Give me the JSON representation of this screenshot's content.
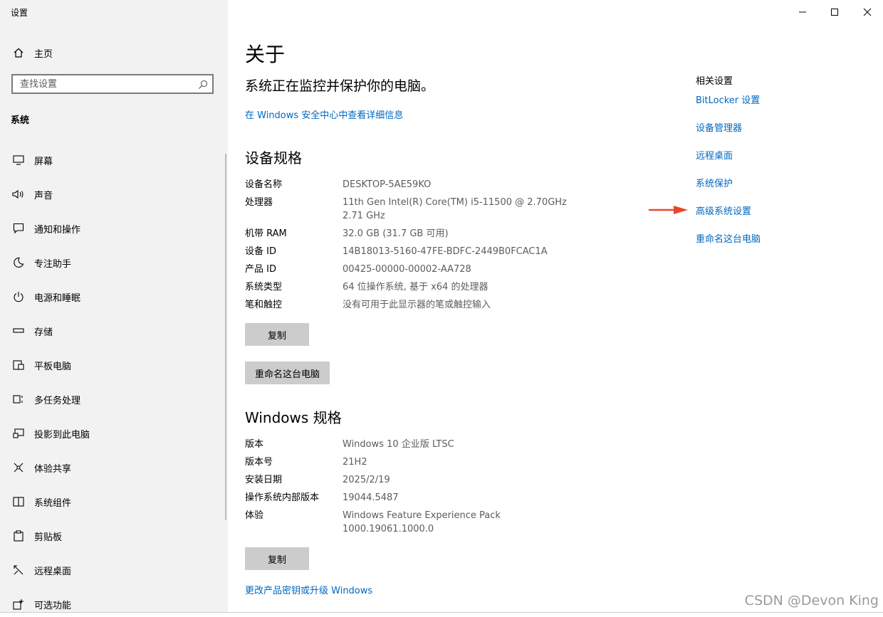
{
  "window": {
    "app_title": "设置",
    "controls": {
      "minimize": "minimize-icon",
      "maximize": "maximize-icon",
      "close": "close-icon"
    }
  },
  "sidebar": {
    "home_label": "主页",
    "search_placeholder": "查找设置",
    "section_label": "系统",
    "items": [
      {
        "label": "屏幕",
        "icon": "monitor-icon"
      },
      {
        "label": "声音",
        "icon": "speaker-icon"
      },
      {
        "label": "通知和操作",
        "icon": "notification-icon"
      },
      {
        "label": "专注助手",
        "icon": "moon-icon"
      },
      {
        "label": "电源和睡眠",
        "icon": "power-icon"
      },
      {
        "label": "存储",
        "icon": "storage-icon"
      },
      {
        "label": "平板电脑",
        "icon": "tablet-icon"
      },
      {
        "label": "多任务处理",
        "icon": "multitask-icon"
      },
      {
        "label": "投影到此电脑",
        "icon": "project-icon"
      },
      {
        "label": "体验共享",
        "icon": "share-icon"
      },
      {
        "label": "系统组件",
        "icon": "components-icon"
      },
      {
        "label": "剪贴板",
        "icon": "clipboard-icon"
      },
      {
        "label": "远程桌面",
        "icon": "remote-icon"
      },
      {
        "label": "可选功能",
        "icon": "optional-icon"
      }
    ]
  },
  "main": {
    "title": "关于",
    "protect_message": "系统正在监控并保护你的电脑。",
    "security_link": "在 Windows 安全中心中查看详细信息",
    "device_specs": {
      "heading": "设备规格",
      "rows": [
        {
          "key": "设备名称",
          "value": "DESKTOP-5AE59KO"
        },
        {
          "key": "处理器",
          "value": "11th Gen Intel(R) Core(TM) i5-11500 @ 2.70GHz",
          "value2": "2.71 GHz"
        },
        {
          "key": "机带 RAM",
          "value": "32.0 GB (31.7 GB 可用)"
        },
        {
          "key": "设备 ID",
          "value": "14B18013-5160-47FE-BDFC-2449B0FCAC1A"
        },
        {
          "key": "产品 ID",
          "value": "00425-00000-00002-AA728"
        },
        {
          "key": "系统类型",
          "value": "64 位操作系统, 基于 x64 的处理器"
        },
        {
          "key": "笔和触控",
          "value": "没有可用于此显示器的笔或触控输入"
        }
      ],
      "copy_button": "复制",
      "rename_button": "重命名这台电脑"
    },
    "windows_specs": {
      "heading": "Windows 规格",
      "rows": [
        {
          "key": "版本",
          "value": "Windows 10 企业版 LTSC"
        },
        {
          "key": "版本号",
          "value": "21H2"
        },
        {
          "key": "安装日期",
          "value": "2025/2/19"
        },
        {
          "key": "操作系统内部版本",
          "value": "19044.5487"
        },
        {
          "key": "体验",
          "value": "Windows Feature Experience Pack",
          "value2": "1000.19061.1000.0"
        }
      ],
      "copy_button": "复制",
      "product_key_link": "更改产品密钥或升级 Windows"
    }
  },
  "related": {
    "title": "相关设置",
    "links": [
      "BitLocker 设置",
      "设备管理器",
      "远程桌面",
      "系统保护",
      "高级系统设置",
      "重命名这台电脑"
    ],
    "highlighted": "高级系统设置",
    "arrow_color": "#e8472d"
  },
  "watermark": "CSDN @Devon King",
  "colors": {
    "link": "#0067c0",
    "sidebar_bg": "#f2f2f2",
    "button_bg": "#cccccc"
  }
}
